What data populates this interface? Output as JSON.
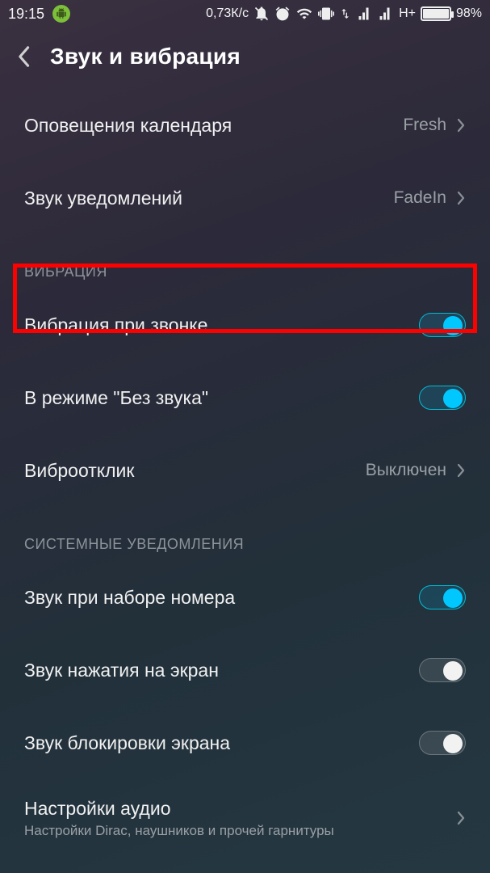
{
  "status": {
    "time": "19:15",
    "net_speed": "0,73К/с",
    "network_label": "H+",
    "battery_pct": "98%"
  },
  "header": {
    "title": "Звук и вибрация"
  },
  "rows": {
    "calendar_alerts": {
      "label": "Оповещения календаря",
      "value": "Fresh"
    },
    "notification_sound": {
      "label": "Звук уведомлений",
      "value": "FadeIn"
    }
  },
  "section_vibration": "ВИБРАЦИЯ",
  "vibration": {
    "on_ring": {
      "label": "Вибрация при звонке",
      "on": true
    },
    "silent_mode": {
      "label": "В режиме \"Без звука\"",
      "on": true
    },
    "haptic": {
      "label": "Виброотклик",
      "value": "Выключен"
    }
  },
  "section_system": "СИСТЕМНЫЕ УВЕДОМЛЕНИЯ",
  "system": {
    "dial_pad": {
      "label": "Звук при наборе номера",
      "on": true
    },
    "touch": {
      "label": "Звук нажатия на экран",
      "on": false
    },
    "lock": {
      "label": "Звук блокировки экрана",
      "on": false
    },
    "audio": {
      "label": "Настройки аудио",
      "sub": "Настройки Dirac, наушников и прочей гарнитуры"
    }
  }
}
